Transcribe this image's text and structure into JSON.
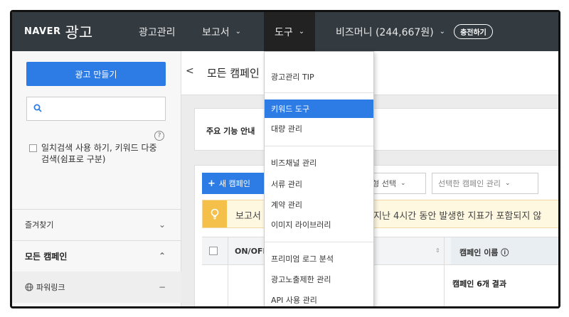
{
  "topnav": {
    "logo_brand": "NAVER",
    "logo_product": "광고",
    "items": [
      {
        "label": "광고관리",
        "chevron": ""
      },
      {
        "label": "보고서",
        "chevron": "⌄"
      },
      {
        "label": "도구",
        "chevron": "⌄"
      },
      {
        "label": "비즈머니 (244,667원)",
        "chevron": "⌄"
      }
    ],
    "charge_label": "충전하기"
  },
  "sidebar": {
    "create_label": "광고 만들기",
    "search_placeholder": "",
    "help_mark": "?",
    "checkbox_label": "일치검색 사용 하기, 키워드 다중검색(쉼표로 구분)",
    "favorites_label": "즐겨찾기",
    "favorites_mark": "⌄",
    "all_campaigns_label": "모든 캠페인",
    "all_campaigns_mark": "⌃",
    "powerlink_label": "파워링크",
    "powerlink_mark": "−"
  },
  "main": {
    "back_mark": "<",
    "page_title": "모든 캠페인",
    "notice_title": "주요 기능 안내",
    "new_campaign_label": "새 캠페인",
    "type_select_label": "유형 선택",
    "campaign_manage_label": "선택한 캠페인 관리",
    "info_text_left": "보고서",
    "info_text_right": "지난 4시간 동안 발생한 지표가 포함되지 않",
    "col_onoff": "ON/OFF",
    "col_name": "캠페인 이름 ⓘ",
    "result_text": "캠페인 6개 결과"
  },
  "dropdown": {
    "items": [
      {
        "label": "광고관리 TIP",
        "active": false
      },
      {
        "label": "키워드 도구",
        "active": true
      },
      {
        "label": "대량 관리",
        "active": false
      },
      {
        "label": "비즈채널 관리",
        "active": false
      },
      {
        "label": "서류 관리",
        "active": false
      },
      {
        "label": "계약 관리",
        "active": false
      },
      {
        "label": "이미지 라이브러리",
        "active": false
      },
      {
        "label": "프리미엄 로그 분석",
        "active": false
      },
      {
        "label": "광고노출제한 관리",
        "active": false
      },
      {
        "label": "API 사용 관리",
        "active": false
      }
    ]
  },
  "colors": {
    "nav_bg": "#333a40",
    "accent_blue": "#2d7ce6",
    "tip_yellow": "#f5c04a"
  }
}
